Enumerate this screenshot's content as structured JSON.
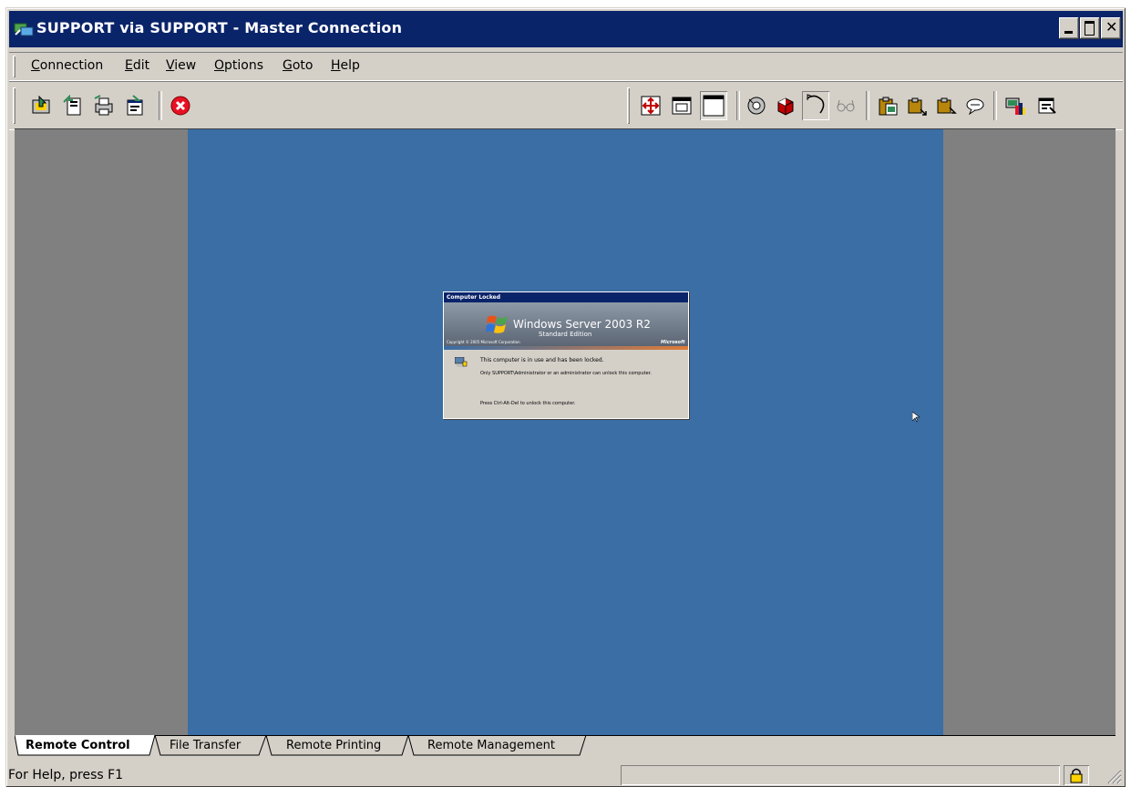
{
  "window": {
    "title": "SUPPORT via SUPPORT - Master Connection",
    "controls": [
      "minimize",
      "maximize",
      "close"
    ]
  },
  "menu": {
    "items": [
      {
        "label": "Connection",
        "mnemonic": "C"
      },
      {
        "label": "Edit",
        "mnemonic": "E"
      },
      {
        "label": "View",
        "mnemonic": "V"
      },
      {
        "label": "Options",
        "mnemonic": "O"
      },
      {
        "label": "Goto",
        "mnemonic": "G"
      },
      {
        "label": "Help",
        "mnemonic": "H"
      }
    ]
  },
  "toolbar": {
    "left_icons": [
      "connect-icon",
      "transfer-icon",
      "print-icon",
      "properties-icon",
      "stop-icon"
    ],
    "right_icons": [
      "full-screen-icon",
      "window-icon",
      "scale-icon",
      "refresh-icon",
      "record-icon",
      "watch-mode-icon",
      "glasses-icon",
      "clipboard-icon",
      "clipboard-send-icon",
      "clipboard-get-icon",
      "chat-icon",
      "system-info-icon",
      "settings-icon"
    ]
  },
  "remote_screen": {
    "background_color": "#3a6ea5",
    "dialog": {
      "title": "Computer Locked",
      "product": "Windows Server 2003 R2",
      "edition": "Standard Edition",
      "copyright": "Copyright © 2005 Microsoft Corporation",
      "brand": "Microsoft",
      "message": "This computer is in use and has been locked.",
      "detail": "Only SUPPORT\\Administrator or an administrator can unlock this computer.",
      "instruction": "Press Ctrl-Alt-Del to unlock this computer."
    }
  },
  "tabs": [
    {
      "label": "Remote Control",
      "active": true
    },
    {
      "label": "File Transfer",
      "active": false
    },
    {
      "label": "Remote Printing",
      "active": false
    },
    {
      "label": "Remote Management",
      "active": false
    }
  ],
  "status": {
    "help_text": "For Help, press F1",
    "lock_icon": "lock-icon"
  },
  "colors": {
    "title_bar": "#0a246a",
    "chrome": "#d4d0c8",
    "viewport_bg": "#808080"
  }
}
